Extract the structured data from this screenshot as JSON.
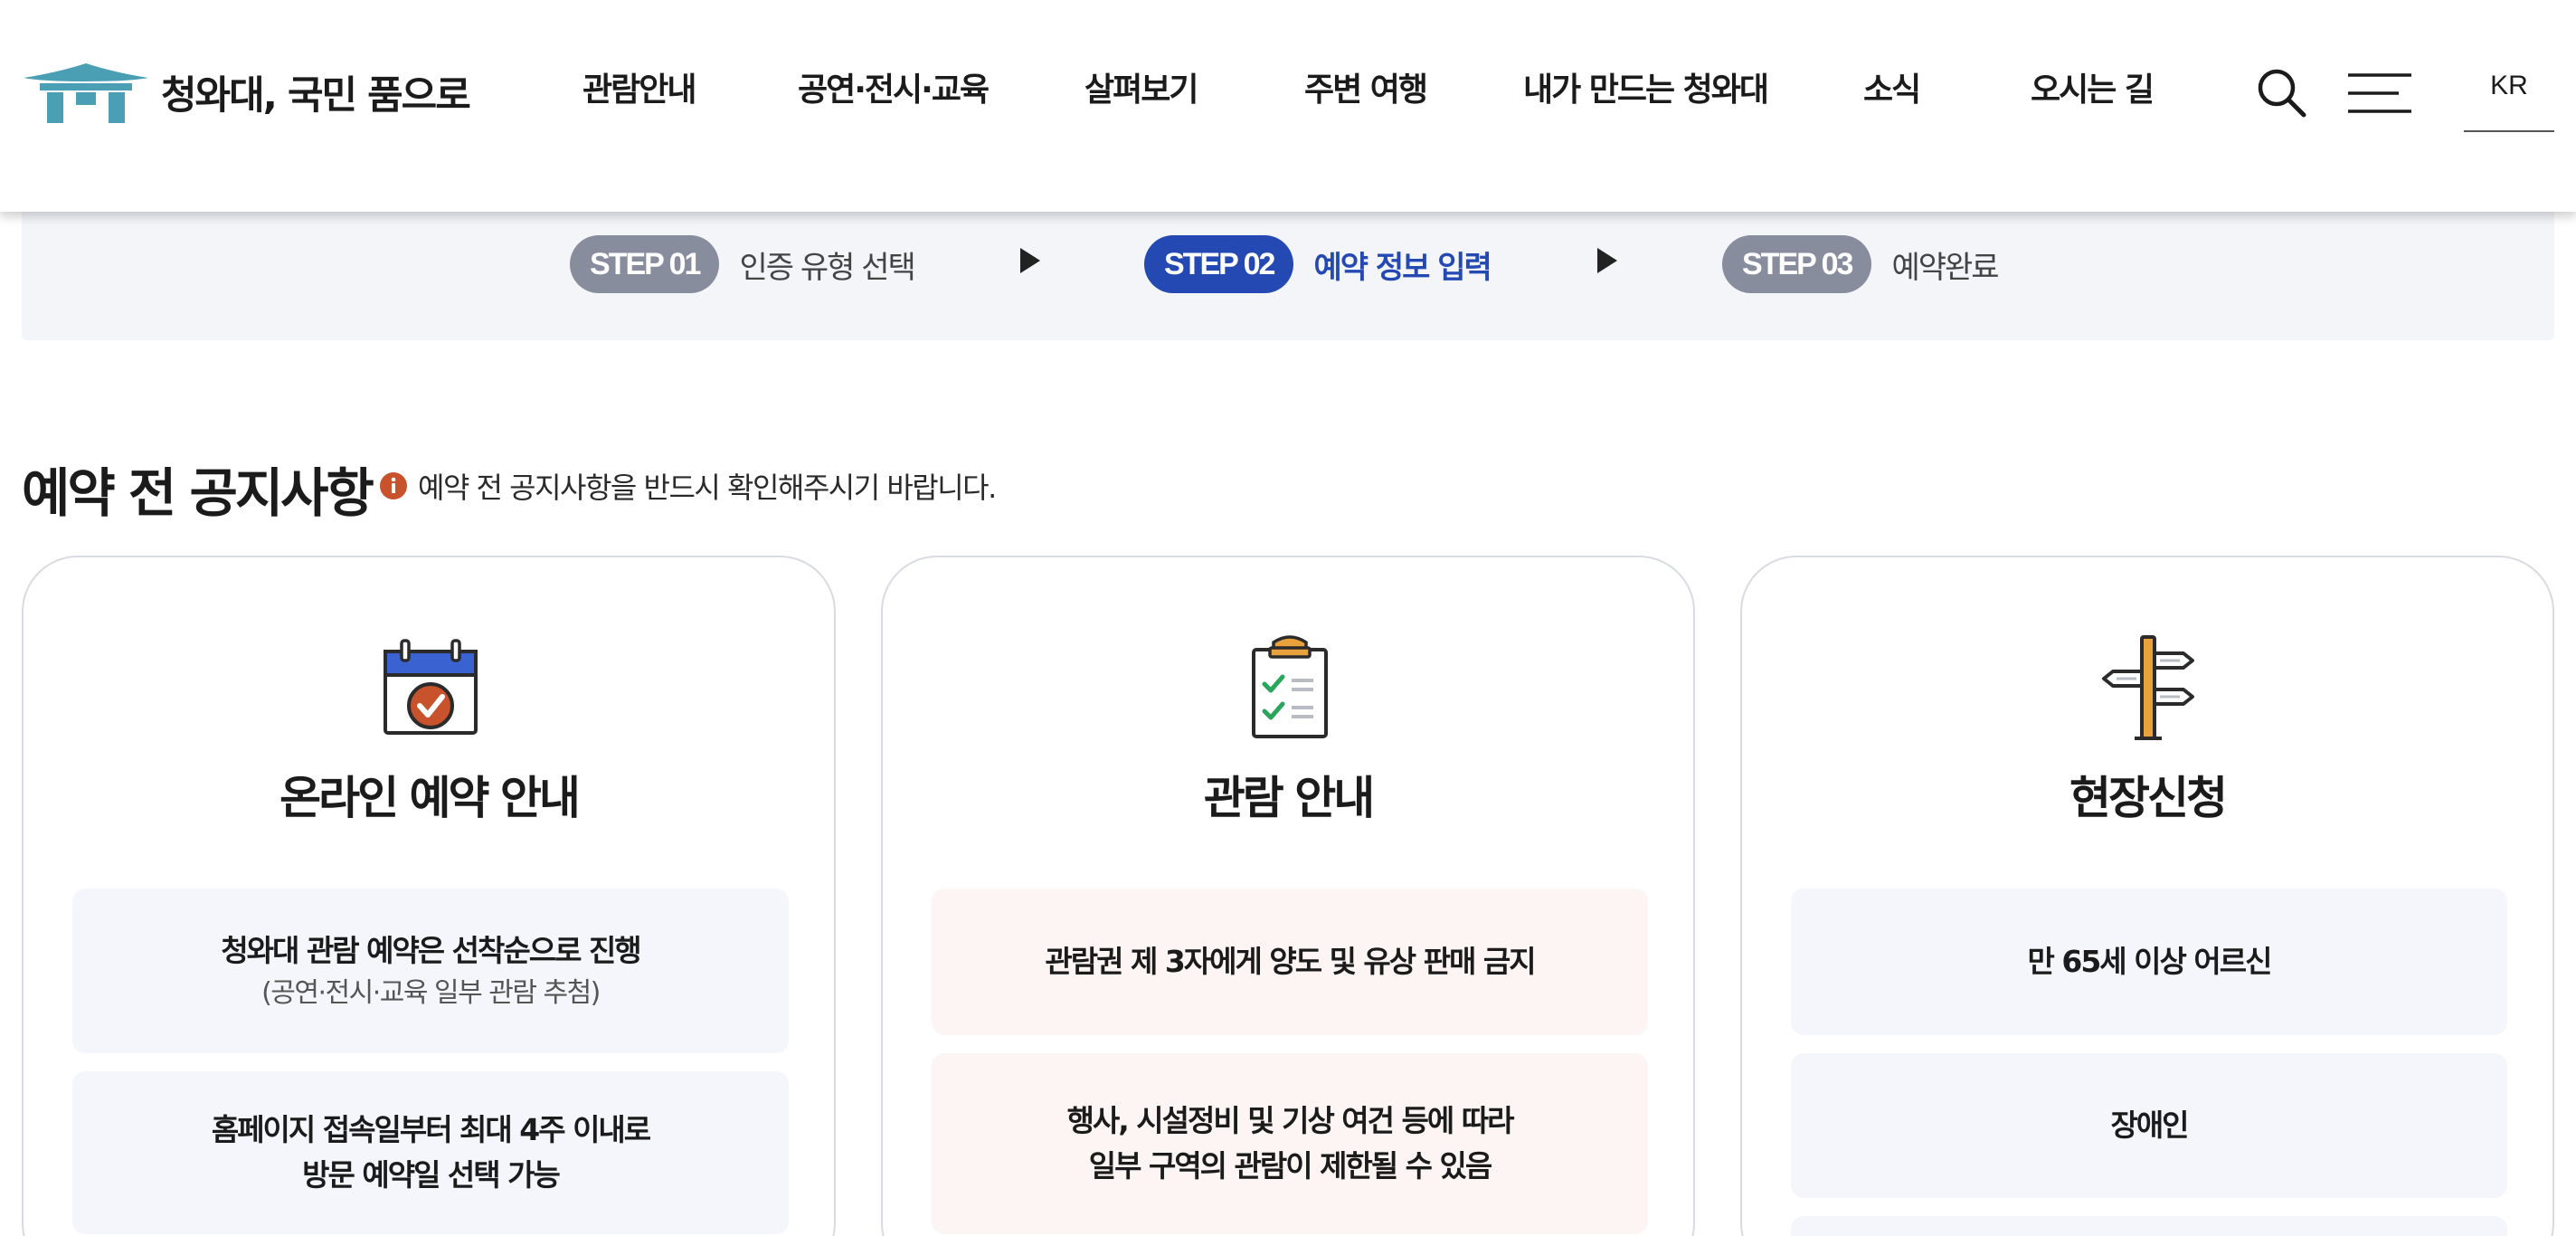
{
  "header": {
    "logo_text": "청와대, 국민 품으로",
    "nav": [
      {
        "label": "관람안내"
      },
      {
        "label": "공연·전시·교육"
      },
      {
        "label": "살펴보기"
      },
      {
        "label": "주변 여행"
      },
      {
        "label": "내가 만드는 청와대"
      },
      {
        "label": "소식"
      },
      {
        "label": "오시는 길"
      }
    ],
    "lang": "KR"
  },
  "steps": [
    {
      "badge": "STEP 01",
      "label": "인증 유형 선택",
      "active": false
    },
    {
      "badge": "STEP 02",
      "label": "예약 정보 입력",
      "active": true
    },
    {
      "badge": "STEP 03",
      "label": "예약완료",
      "active": false
    }
  ],
  "notice": {
    "title": "예약 전 공지사항",
    "subtitle": "예약 전 공지사항을 반드시 확인해주시기 바랍니다."
  },
  "cards": [
    {
      "icon": "calendar-check-icon",
      "title": "온라인 예약 안내",
      "boxes": [
        {
          "lines": [
            "청와대 관람 예약은 선착순으로 진행"
          ],
          "sub": "(공연·전시·교육 일부 관람 추첨)"
        },
        {
          "lines": [
            "홈페이지 접속일부터 최대 4주 이내로",
            "방문 예약일 선택 가능"
          ],
          "sub": ""
        }
      ]
    },
    {
      "icon": "clipboard-checklist-icon",
      "title": "관람 안내",
      "boxes": [
        {
          "lines": [
            "관람권 제 3자에게 양도 및 유상 판매 금지"
          ],
          "sub": ""
        },
        {
          "lines": [
            "행사, 시설정비 및 기상 여건 등에 따라",
            "일부 구역의 관람이 제한될 수 있음"
          ],
          "sub": ""
        }
      ]
    },
    {
      "icon": "signpost-icon",
      "title": "현장신청",
      "boxes": [
        {
          "lines": [
            "만 65세 이상 어르신"
          ],
          "sub": ""
        },
        {
          "lines": [
            "장애인"
          ],
          "sub": ""
        }
      ]
    }
  ],
  "colors": {
    "accent": "#2449b3",
    "step_inactive": "#888d9e",
    "logo": "#4a9fb4",
    "info_icon": "#c8522c"
  }
}
